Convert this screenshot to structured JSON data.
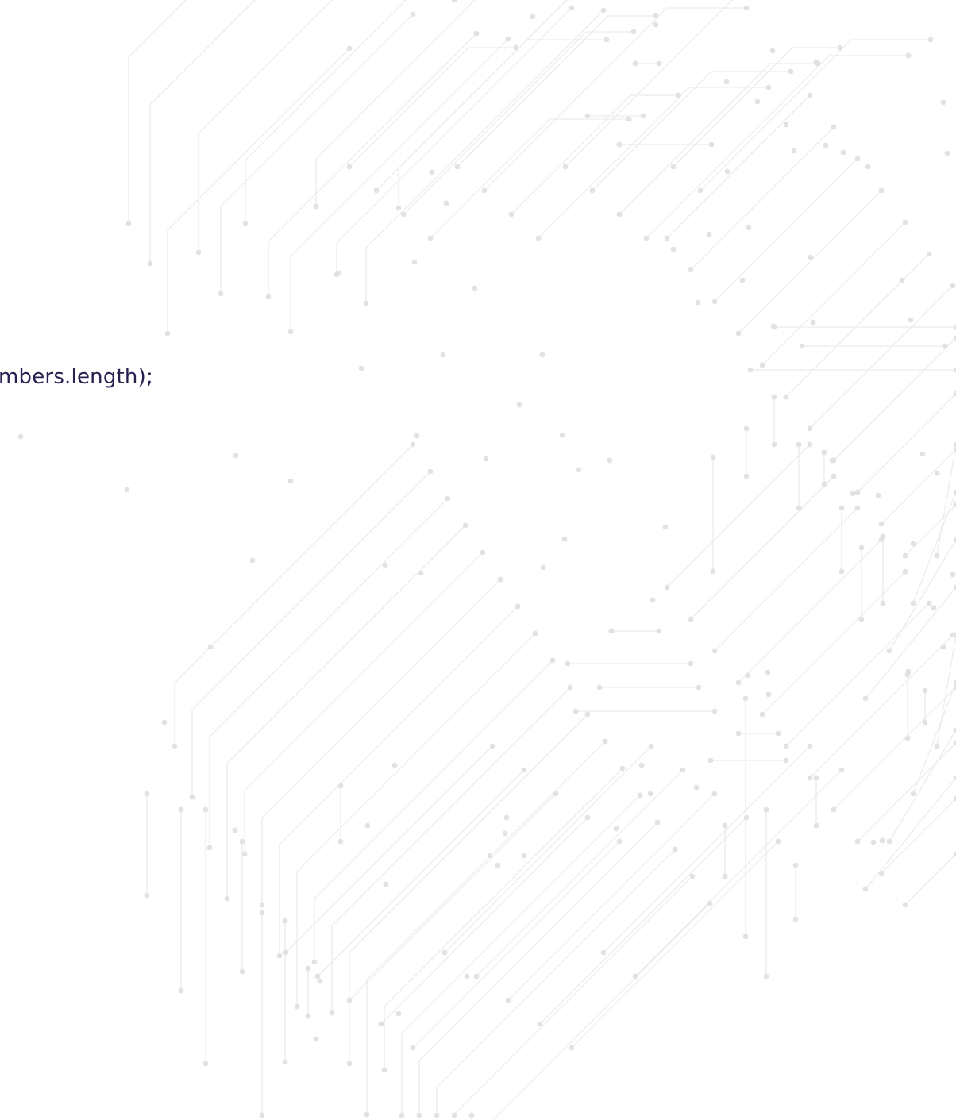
{
  "code": {
    "visible_text": "mbers.length);"
  },
  "colors": {
    "background": "#ffffff",
    "code_text": "#262250",
    "circuit_trace": "#ececec",
    "circuit_node": "#e2e2e2"
  },
  "decoration": {
    "icon": "circuit-board-pattern"
  }
}
